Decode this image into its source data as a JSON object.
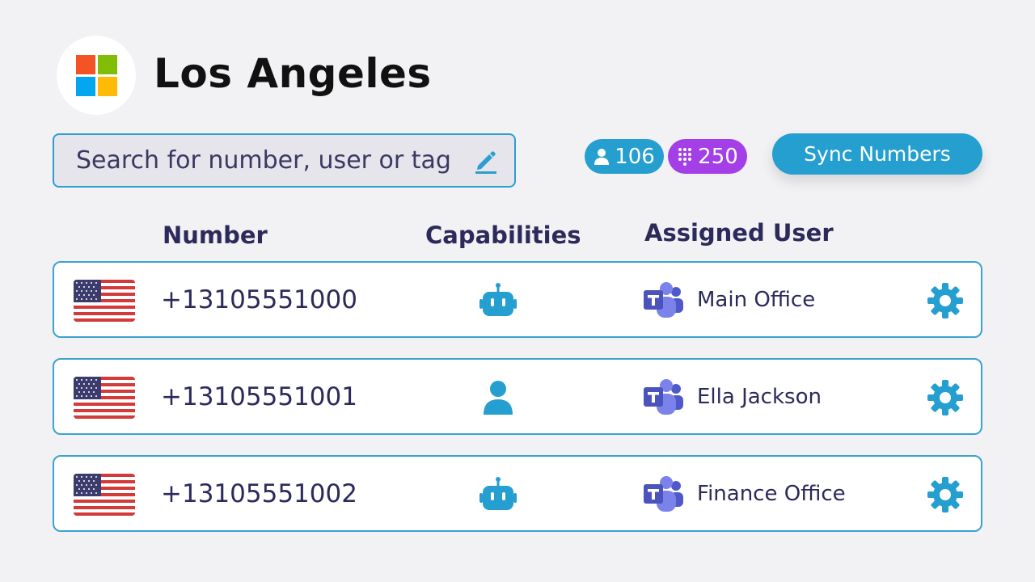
{
  "header": {
    "title": "Los Angeles",
    "logo": "microsoft-logo",
    "logo_colors": [
      "#f35325",
      "#81bc06",
      "#05a6f0",
      "#ffba08"
    ]
  },
  "search": {
    "placeholder": "Search for number, user or tag",
    "icon": "edit-icon"
  },
  "stats": {
    "users_count": "106",
    "numbers_count": "250",
    "users_color": "#249fd0",
    "numbers_color": "#a43ee6"
  },
  "toolbar": {
    "sync_label": "Sync Numbers"
  },
  "columns": {
    "number": "Number",
    "capabilities": "Capabilities",
    "assigned_user": "Assigned User"
  },
  "rows": [
    {
      "flag": "us-flag",
      "number": "+13105551000",
      "capability": "bot-icon",
      "assigned": "Main Office",
      "assigned_icon": "teams-icon"
    },
    {
      "flag": "us-flag",
      "number": "+13105551001",
      "capability": "user-icon",
      "assigned": "Ella Jackson",
      "assigned_icon": "teams-icon"
    },
    {
      "flag": "us-flag",
      "number": "+13105551002",
      "capability": "bot-icon",
      "assigned": "Finance Office",
      "assigned_icon": "teams-icon"
    }
  ],
  "colors": {
    "accent": "#249fd0",
    "text": "#2b2a5a",
    "background": "#f2f1f4"
  }
}
